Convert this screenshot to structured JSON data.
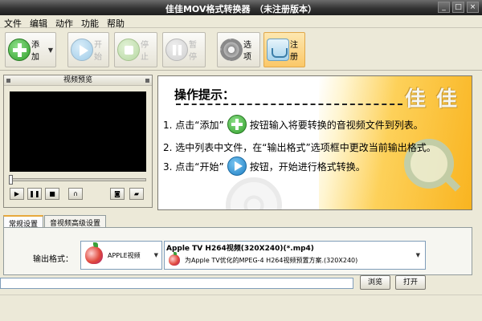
{
  "window": {
    "title": "佳佳MOV格式转换器　（未注册版本）",
    "controls": [
      "_",
      "□",
      "×"
    ]
  },
  "menu": [
    "文件",
    "编辑",
    "动作",
    "功能",
    "帮助"
  ],
  "toolbar": {
    "add": "添加",
    "start": "开始",
    "stop": "停止",
    "pause": "暂停",
    "options": "选项",
    "register": "注册"
  },
  "preview": {
    "title": "视频预览",
    "progress": 0
  },
  "tips": {
    "heading": "操作提示：",
    "brand": "佳 佳",
    "step1_a": "1. 点击“添加”",
    "step1_b": "按钮输入将要转换的音视频文件到列表。",
    "step2": "2. 选中列表中文件，在“输出格式”选项框中更改当前输出格式。",
    "step3_a": "3. 点击“开始”",
    "step3_b": "按钮，开始进行格式转换。"
  },
  "tabs": [
    "常规设置",
    "音视频高级设置"
  ],
  "settings": {
    "output_format_label": "输出格式：",
    "category": "APPLE视频",
    "profile_title": "Apple TV H264视频(320X240)(*.mp4)",
    "profile_desc": "为Apple TV优化的MPEG-4 H264视频预置方案.(320X240)"
  },
  "buttons": {
    "browse": "浏览",
    "open": "打开"
  },
  "output_path": ""
}
